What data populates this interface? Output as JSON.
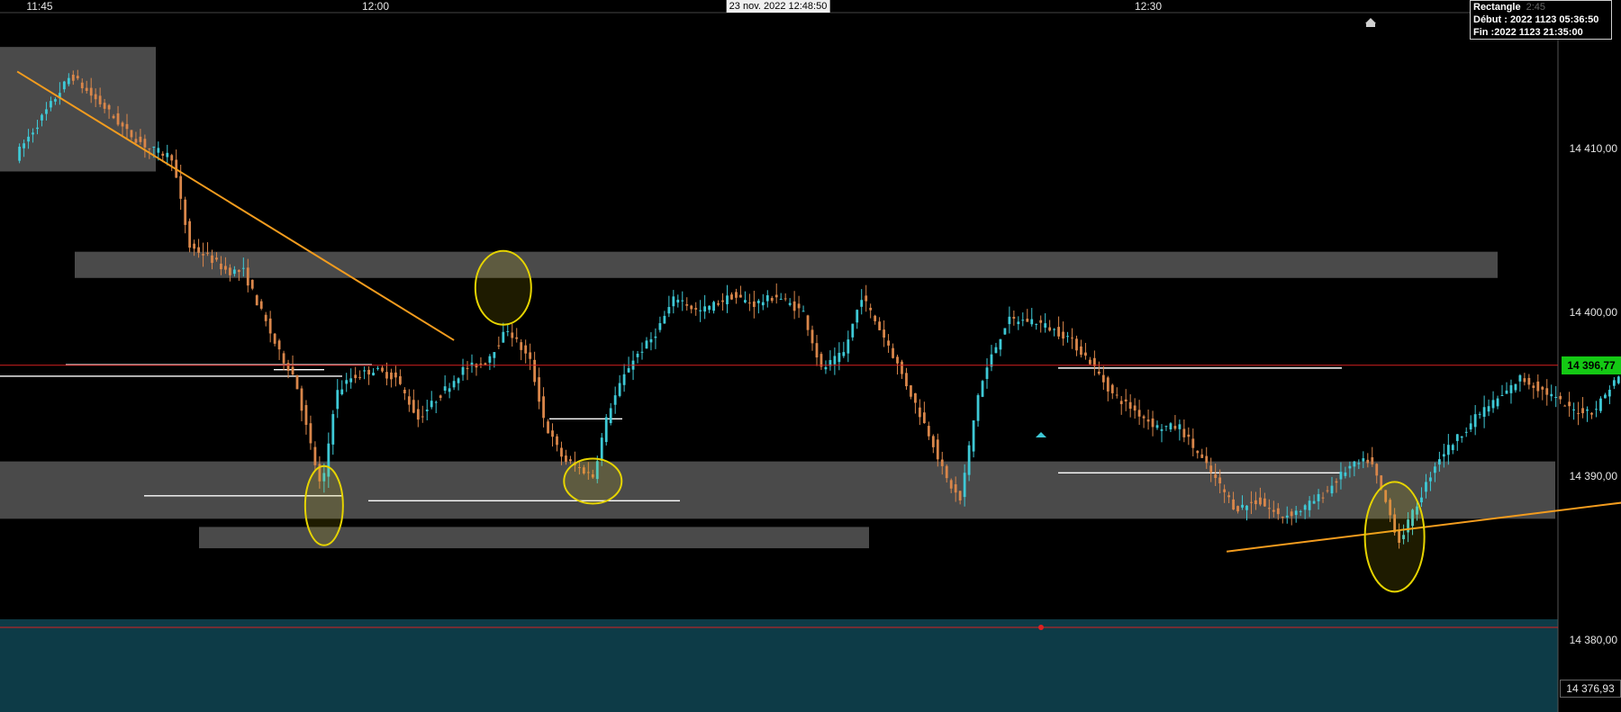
{
  "time_axis": {
    "labels": [
      {
        "text": "11:45",
        "minute": 0
      },
      {
        "text": "12:00",
        "minute": 15
      },
      {
        "text": "12:30",
        "minute": 45
      }
    ],
    "cursor_date": "23 nov. 2022 12:48:50"
  },
  "info_box": {
    "title": "Rectangle",
    "ghost": "2:45",
    "start": "Début : 2022 1123 05:36:50",
    "end": "Fin :2022 1123 21:35:00"
  },
  "price_axis": {
    "labels": [
      "14 410,00",
      "14 400,00",
      "14 390,00",
      "14 380,00"
    ],
    "current_price": "14 396,77",
    "bottom_price": "14 376,93"
  },
  "colors": {
    "background": "#000000",
    "bull": "#3ec9d6",
    "bear": "#d9864a",
    "trendline": "#f39c1e",
    "ellipse": "#e6d400",
    "zone": "#5a5a5a",
    "level_line": "#ffffff",
    "price_line": "#d62020",
    "lower_panel": "#0d3b47",
    "current_price_badge": "#14c814"
  },
  "chart_data": {
    "type": "candlestick",
    "x_axis": "time (minutes from 11:45)",
    "y_axis": "price",
    "ylim": [
      14376.93,
      14418.5
    ],
    "current_price": 14396.77,
    "price_path": [
      [
        -1,
        14409.5
      ],
      [
        0.5,
        14412.5
      ],
      [
        1.5,
        14414.5
      ],
      [
        2.2,
        14413.5
      ],
      [
        3,
        14412.5
      ],
      [
        4,
        14411
      ],
      [
        5,
        14410
      ],
      [
        6,
        14409.5
      ],
      [
        6.8,
        14404
      ],
      [
        7.5,
        14403.5
      ],
      [
        8.5,
        14402.5
      ],
      [
        9.2,
        14402.5
      ],
      [
        10,
        14400
      ],
      [
        10.8,
        14397.5
      ],
      [
        11.5,
        14396
      ],
      [
        12,
        14393
      ],
      [
        12.7,
        14389
      ],
      [
        13.3,
        14395
      ],
      [
        14,
        14396
      ],
      [
        15,
        14396.5
      ],
      [
        16,
        14396
      ],
      [
        17,
        14393.5
      ],
      [
        18,
        14395
      ],
      [
        19,
        14396.5
      ],
      [
        20,
        14397
      ],
      [
        21,
        14399
      ],
      [
        22,
        14397
      ],
      [
        22.7,
        14393
      ],
      [
        23.5,
        14391
      ],
      [
        24.2,
        14390.5
      ],
      [
        24.8,
        14390
      ],
      [
        25.5,
        14394
      ],
      [
        26.5,
        14397
      ],
      [
        27.5,
        14398.5
      ],
      [
        28.5,
        14401
      ],
      [
        29.5,
        14400
      ],
      [
        31,
        14401
      ],
      [
        32,
        14400.5
      ],
      [
        33,
        14401
      ],
      [
        34.2,
        14400
      ],
      [
        35,
        14396.5
      ],
      [
        36,
        14397.5
      ],
      [
        36.8,
        14401
      ],
      [
        38,
        14398
      ],
      [
        39,
        14395
      ],
      [
        40,
        14392
      ],
      [
        40.5,
        14390
      ],
      [
        41.2,
        14388.5
      ],
      [
        42,
        14395
      ],
      [
        42.5,
        14397
      ],
      [
        43.3,
        14399.5
      ],
      [
        44.5,
        14399.5
      ],
      [
        46,
        14398.5
      ],
      [
        47,
        14397
      ],
      [
        48,
        14395
      ],
      [
        49,
        14394
      ],
      [
        50,
        14393
      ],
      [
        51,
        14393
      ],
      [
        52,
        14391
      ],
      [
        53,
        14389
      ],
      [
        53.5,
        14388
      ],
      [
        54.5,
        14388.5
      ],
      [
        55.5,
        14387.5
      ],
      [
        56.5,
        14388
      ],
      [
        57.5,
        14389
      ],
      [
        58.5,
        14390.5
      ],
      [
        59.5,
        14391
      ],
      [
        60.3,
        14388
      ],
      [
        60.8,
        14386
      ],
      [
        61.5,
        14388
      ],
      [
        62.5,
        14391
      ],
      [
        63.5,
        14392.5
      ],
      [
        64.5,
        14394
      ],
      [
        65.5,
        14395
      ],
      [
        66.2,
        14396
      ],
      [
        67.5,
        14395
      ],
      [
        68.5,
        14394
      ],
      [
        69.5,
        14394
      ],
      [
        70.5,
        14396
      ],
      [
        71.3,
        14396
      ],
      [
        72.5,
        14395.5
      ],
      [
        73.5,
        14395
      ],
      [
        74,
        14391
      ],
      [
        74.6,
        14391
      ],
      [
        75.5,
        14393
      ],
      [
        76.5,
        14394.5
      ],
      [
        77.5,
        14394
      ],
      [
        78.5,
        14394.5
      ],
      [
        79.2,
        14396
      ],
      [
        80,
        14393.5
      ],
      [
        81,
        14393
      ],
      [
        81.8,
        14392
      ],
      [
        82.7,
        14391
      ],
      [
        83.5,
        14390
      ],
      [
        84.3,
        14394
      ],
      [
        85,
        14396.5
      ],
      [
        85.8,
        14397
      ]
    ],
    "horizontal_levels": [
      14396.8,
      14396.5,
      14393.5,
      14396.1,
      14388.5,
      14390.2,
      14388.8,
      14396.6
    ],
    "trendlines": [
      {
        "from": [
          -1,
          14414.7
        ],
        "to": [
          18.5,
          14398.3
        ]
      },
      {
        "from": [
          53,
          14385.4
        ],
        "to": [
          88.5,
          14391.4
        ]
      }
    ],
    "zones": [
      {
        "from_price": 14408.6,
        "to_price": 14416.2
      },
      {
        "from_price": 14402.1,
        "to_price": 14403.7
      },
      {
        "from_price": 14387.4,
        "to_price": 14390.9
      },
      {
        "from_price": 14385.6,
        "to_price": 14386.9
      }
    ],
    "ellipses": [
      {
        "minute": 12.7,
        "price": 14388.2
      },
      {
        "minute": 20.7,
        "price": 14401.5
      },
      {
        "minute": 24.7,
        "price": 14389.7
      },
      {
        "minute": 60.5,
        "price": 14386.3
      }
    ]
  }
}
